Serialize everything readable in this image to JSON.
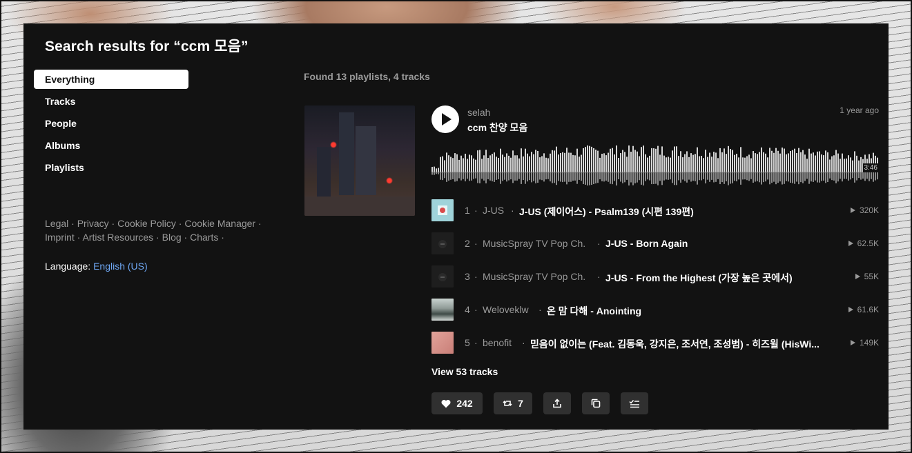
{
  "header": {
    "title": "Search results for “ccm 모음”"
  },
  "nav": {
    "items": [
      {
        "label": "Everything"
      },
      {
        "label": "Tracks"
      },
      {
        "label": "People"
      },
      {
        "label": "Albums"
      },
      {
        "label": "Playlists"
      }
    ]
  },
  "footer": {
    "links": [
      "Legal",
      "Privacy",
      "Cookie Policy",
      "Cookie Manager",
      "Imprint",
      "Artist Resources",
      "Blog",
      "Charts"
    ],
    "separator": " · ",
    "language_label": "Language:",
    "language_value": "English (US)"
  },
  "results": {
    "summary": "Found 13 playlists, 4 tracks"
  },
  "playlist": {
    "uploader": "selah",
    "title": "ccm 찬양 모음",
    "posted": "1 year ago",
    "duration": "3:46",
    "tracks": [
      {
        "index": "1",
        "artist": "J-US",
        "title": "J-US (제이어스) - Psalm139 (시편 139편)",
        "plays": "320K"
      },
      {
        "index": "2",
        "artist": "MusicSpray TV Pop Ch.",
        "title": "J-US - Born Again",
        "plays": "62.5K"
      },
      {
        "index": "3",
        "artist": "MusicSpray TV Pop Ch.",
        "title": "J-US - From the Highest (가장 높은 곳에서)",
        "plays": "55K"
      },
      {
        "index": "4",
        "artist": "Weloveklw",
        "title": "온 맘 다해 - Anointing",
        "plays": "61.6K"
      },
      {
        "index": "5",
        "artist": "benofit",
        "title": "믿음이 없이는 (Feat. 김동욱, 강지은, 조서연, 조성범) - 히즈윌 (HisWi...",
        "plays": "149K"
      }
    ],
    "view_all": "View 53 tracks",
    "actions": {
      "likes": "242",
      "reposts": "7"
    }
  },
  "icons": {
    "play": "play-icon",
    "like": "heart-icon",
    "repost": "repost-icon",
    "share": "share-icon",
    "copy": "copy-link-icon",
    "queue": "add-to-queue-icon"
  },
  "colors": {
    "panel_bg": "#121212",
    "link_blue": "#6fa8f5",
    "muted_text": "#9a9a9a",
    "button_bg": "#303030"
  }
}
